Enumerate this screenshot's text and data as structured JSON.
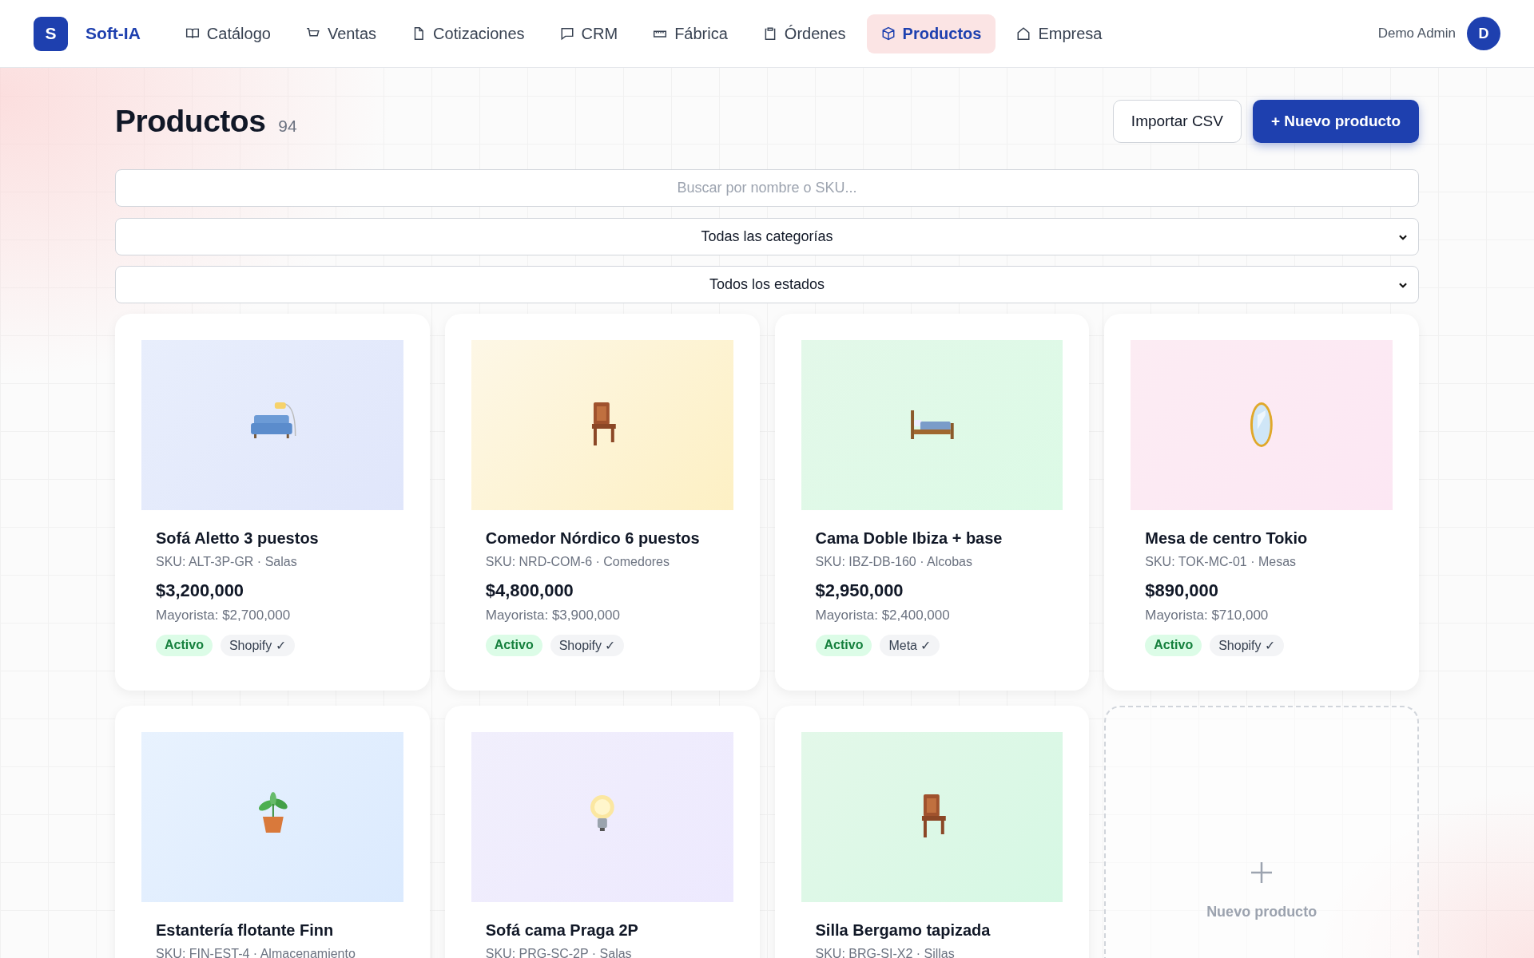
{
  "brand": {
    "logo": "S",
    "name": "Soft-IA"
  },
  "nav": [
    {
      "label": "Catálogo",
      "selected": false
    },
    {
      "label": "Ventas",
      "selected": false
    },
    {
      "label": "Cotizaciones",
      "selected": false
    },
    {
      "label": "CRM",
      "selected": false
    },
    {
      "label": "Fábrica",
      "selected": false
    },
    {
      "label": "Órdenes",
      "selected": false
    },
    {
      "label": "Productos",
      "selected": true
    },
    {
      "label": "Empresa",
      "selected": false
    }
  ],
  "user": {
    "name": "Demo Admin",
    "initial": "D"
  },
  "page": {
    "title": "Productos",
    "count": "94"
  },
  "buttons": {
    "import": "Importar CSV",
    "new": "+ Nuevo producto"
  },
  "search": {
    "placeholder": "Buscar por nombre o SKU..."
  },
  "filters": [
    {
      "value": "Todas las categorías"
    },
    {
      "value": "Todos los estados"
    }
  ],
  "products": [
    {
      "name": "Sofá Aletto 3 puestos",
      "sku": "SKU: ALT-3P-GR · Salas",
      "price": "$3,200,000",
      "wholesale": "Mayorista: $2,700,000",
      "status": "Activo",
      "channel": "Shopify ✓"
    },
    {
      "name": "Comedor Nórdico 6 puestos",
      "sku": "SKU: NRD-COM-6 · Comedores",
      "price": "$4,800,000",
      "wholesale": "Mayorista: $3,900,000",
      "status": "Activo",
      "channel": "Shopify ✓"
    },
    {
      "name": "Cama Doble Ibiza + base",
      "sku": "SKU: IBZ-DB-160 · Alcobas",
      "price": "$2,950,000",
      "wholesale": "Mayorista: $2,400,000",
      "status": "Activo",
      "channel": "Meta ✓"
    },
    {
      "name": "Mesa de centro Tokio",
      "sku": "SKU: TOK-MC-01 · Mesas",
      "price": "$890,000",
      "wholesale": "Mayorista: $710,000",
      "status": "Activo",
      "channel": "Shopify ✓"
    },
    {
      "name": "Estantería flotante Finn",
      "sku": "SKU: FIN-EST-4 · Almacenamiento"
    },
    {
      "name": "Sofá cama Praga 2P",
      "sku": "SKU: PRG-SC-2P · Salas"
    },
    {
      "name": "Silla Bergamo tapizada",
      "sku": "SKU: BRG-SI-X2 · Sillas"
    }
  ],
  "new_card": {
    "label": "Nuevo producto"
  }
}
